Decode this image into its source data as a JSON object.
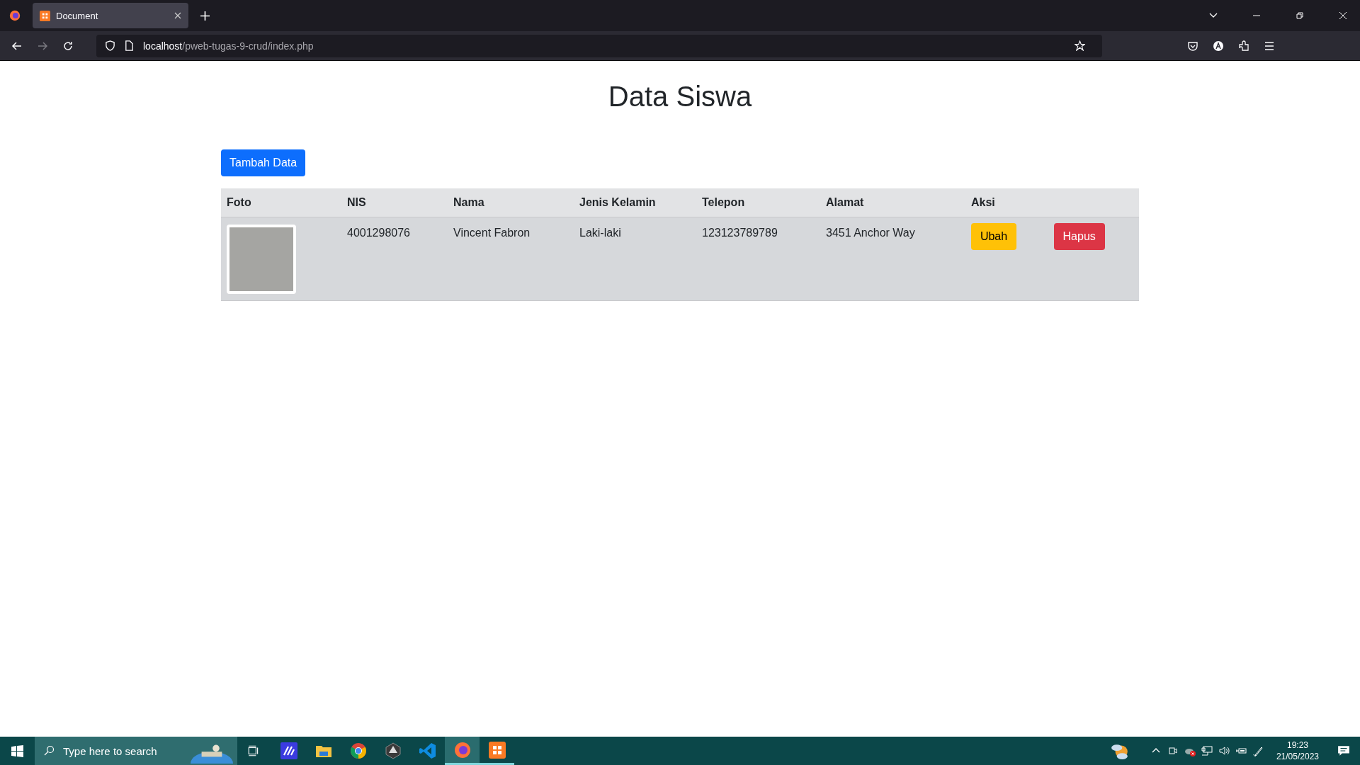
{
  "browser": {
    "tab": {
      "title": "Document",
      "selected": true
    },
    "url": {
      "host": "localhost",
      "path": "/pweb-tugas-9-crud/index.php"
    }
  },
  "page": {
    "title": "Data Siswa",
    "add_button": "Tambah Data",
    "table": {
      "columns": [
        "Foto",
        "NIS",
        "Nama",
        "Jenis Kelamin",
        "Telepon",
        "Alamat",
        "Aksi"
      ],
      "rows": [
        {
          "nis": "4001298076",
          "nama": "Vincent Fabron",
          "jenis_kelamin": "Laki-laki",
          "telepon": "123123789789",
          "alamat": "3451 Anchor Way",
          "actions": [
            {
              "label": "Ubah",
              "kind": "edit"
            },
            {
              "label": "Hapus",
              "kind": "delete"
            }
          ]
        }
      ]
    }
  },
  "taskbar": {
    "search_placeholder": "Type here to search",
    "apps": [
      {
        "kind": "stripes",
        "selected": false,
        "running": false
      },
      {
        "kind": "folder",
        "selected": false,
        "running": false
      },
      {
        "kind": "ring",
        "selected": false,
        "running": false
      },
      {
        "kind": "hexagon",
        "selected": false,
        "running": false
      },
      {
        "kind": "ribbon",
        "selected": false,
        "running": false
      },
      {
        "kind": "fox",
        "selected": true,
        "running": true
      },
      {
        "kind": "tile",
        "selected": false,
        "running": true
      }
    ],
    "time": "19:23",
    "date": "21/05/2023"
  }
}
